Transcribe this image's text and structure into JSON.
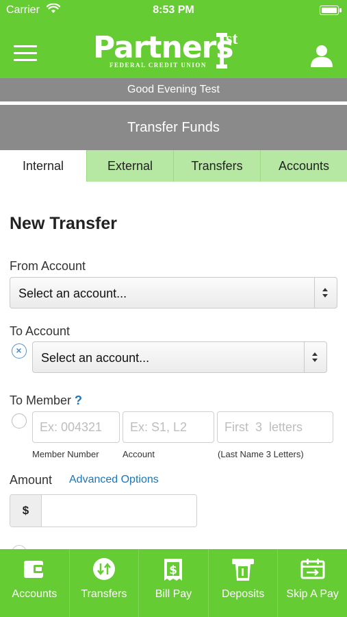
{
  "status_bar": {
    "carrier": "Carrier",
    "time": "8:53 PM"
  },
  "header": {
    "logo_text": "Partners",
    "logo_sup": "st",
    "logo_subtitle": "FEDERAL CREDIT UNION",
    "greeting": "Good Evening Test",
    "page_title": "Transfer Funds"
  },
  "tabs": [
    {
      "label": "Internal",
      "active": true
    },
    {
      "label": "External",
      "active": false
    },
    {
      "label": "Transfers",
      "active": false
    },
    {
      "label": "Accounts",
      "active": false
    }
  ],
  "form": {
    "heading": "New Transfer",
    "from_label": "From Account",
    "from_value": "Select an account...",
    "to_label": "To Account",
    "to_value": "Select an account...",
    "to_member_label": "To Member",
    "help_glyph": "?",
    "member_number_placeholder": "Ex: 004321",
    "account_placeholder": "Ex: S1, L2",
    "last_name_placeholder": "First  3  letters",
    "member_number_caption": "Member Number",
    "account_caption": "Account",
    "last_name_caption": "(Last Name  3  Letters)",
    "amount_label": "Amount",
    "advanced_link": "Advanced Options",
    "currency_symbol": "$",
    "amount_value": ""
  },
  "bottom_nav": [
    {
      "label": "Accounts",
      "icon": "wallet-icon"
    },
    {
      "label": "Transfers",
      "icon": "transfer-arrows-icon"
    },
    {
      "label": "Bill Pay",
      "icon": "bill-icon"
    },
    {
      "label": "Deposits",
      "icon": "deposit-check-icon"
    },
    {
      "label": "Skip A Pay",
      "icon": "calendar-skip-icon"
    }
  ],
  "colors": {
    "brand_green": "#66cc33",
    "gray_bar": "#8a8a8a",
    "tab_green": "#b7e8a3",
    "link_blue": "#1a75bb"
  }
}
